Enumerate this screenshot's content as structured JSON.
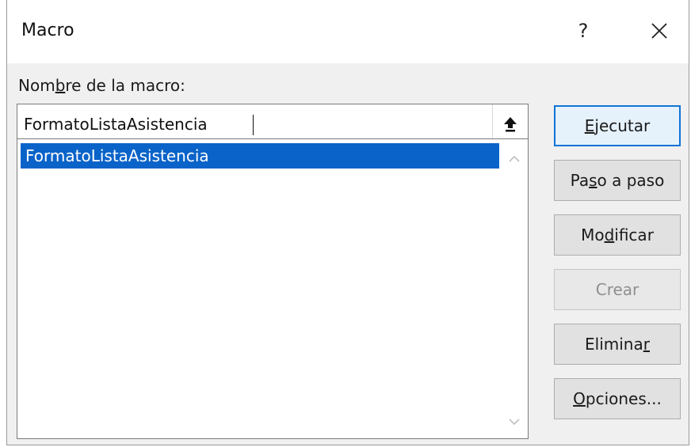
{
  "dialog": {
    "title": "Macro",
    "help_label": "?",
    "name_label": "Nombre de la macro:",
    "name_value": "FormatoListaAsistencia",
    "macros": [
      "FormatoListaAsistencia"
    ],
    "selected_index": 0
  },
  "buttons": {
    "run": {
      "pre": "",
      "key": "E",
      "post": "jecutar"
    },
    "step": {
      "pre": "Pa",
      "key": "s",
      "post": "o a paso"
    },
    "edit": {
      "pre": "Mo",
      "key": "d",
      "post": "ificar"
    },
    "create": {
      "pre": "",
      "key": "",
      "post": "Crear"
    },
    "delete": {
      "pre": "Elimina",
      "key": "r",
      "post": ""
    },
    "options": {
      "pre": "",
      "key": "O",
      "post": "pciones..."
    }
  },
  "icons": {
    "help": "question-mark",
    "close": "close-x",
    "input_arrow": "upload-arrow",
    "scroll_up": "chevron-up",
    "scroll_down": "chevron-down"
  },
  "colors": {
    "selection": "#0a63c9",
    "default_button_border": "#0f73d6"
  }
}
